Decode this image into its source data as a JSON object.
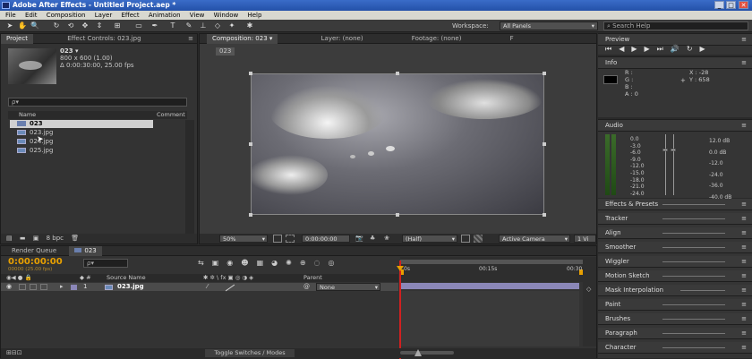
{
  "titlebar": {
    "title": "Adobe After Effects - Untitled Project.aep *",
    "min": "_",
    "max": "□",
    "close": "✕"
  },
  "menu": [
    "File",
    "Edit",
    "Composition",
    "Layer",
    "Effect",
    "Animation",
    "View",
    "Window",
    "Help"
  ],
  "workspace": {
    "label": "Workspace:",
    "value": "All Panels"
  },
  "search_help": {
    "placeholder": "Search Help"
  },
  "project": {
    "tab_project": "Project",
    "tab_effect": "Effect Controls: 023.jpg",
    "item_name": "023 ▾",
    "item_size": "800 x 600 (1.00)",
    "item_dur": "Δ 0:00:30:00, 25.00 fps",
    "search_placeholder": "ρ▾",
    "col_name": "Name",
    "col_comment": "Comment",
    "files": [
      "023",
      "023.jpg",
      "024.jpg",
      "025.jpg"
    ],
    "bpc": "8 bpc"
  },
  "comp": {
    "tab": "Composition: 023",
    "layer_tab": "Layer: (none)",
    "footage_tab": "Footage: (none)",
    "flow_tab": "F",
    "comp_name": "023",
    "zoom": "50%",
    "time": "0:00:00:00",
    "resolution": "(Half)",
    "camera": "Active Camera",
    "views": "1 Vi"
  },
  "preview": {
    "title": "Preview"
  },
  "info": {
    "title": "Info",
    "r": "R :",
    "g": "G :",
    "b": "B :",
    "a": "A : 0",
    "x": "X : -28",
    "y": "Y : 658"
  },
  "audio": {
    "title": "Audio",
    "left_scale": [
      "0.0",
      "-3.0",
      "-6.0",
      "-9.0",
      "-12.0",
      "-15.0",
      "-18.0",
      "-21.0",
      "-24.0"
    ],
    "right_scale": [
      "12.0 dB",
      "0.0 dB",
      "-12.0",
      "-24.0",
      "-36.0",
      "-40.0 dB"
    ]
  },
  "panels": [
    "Effects & Presets",
    "Tracker",
    "Align",
    "Smoother",
    "Wiggler",
    "Motion Sketch",
    "Mask Interpolation",
    "Paint",
    "Brushes",
    "Paragraph",
    "Character"
  ],
  "timeline": {
    "tab_render": "Render Queue",
    "tab_comp": "023",
    "timecode": "0:00:00:00",
    "frames": "00000 (25.00 fps)",
    "search_placeholder": "ρ▾",
    "col_source": "Source Name",
    "col_parent": "Parent",
    "layer_num": "1",
    "layer_name": "023.jpg",
    "parent_value": "None",
    "ruler": [
      "0s",
      "00:15s",
      "00:30"
    ],
    "toggle": "Toggle Switches / Modes"
  },
  "colors": {
    "accent": "#f0a020",
    "timecode": "#e8a000",
    "playhead": "#d02020",
    "layerbar": "#8b87b8"
  }
}
